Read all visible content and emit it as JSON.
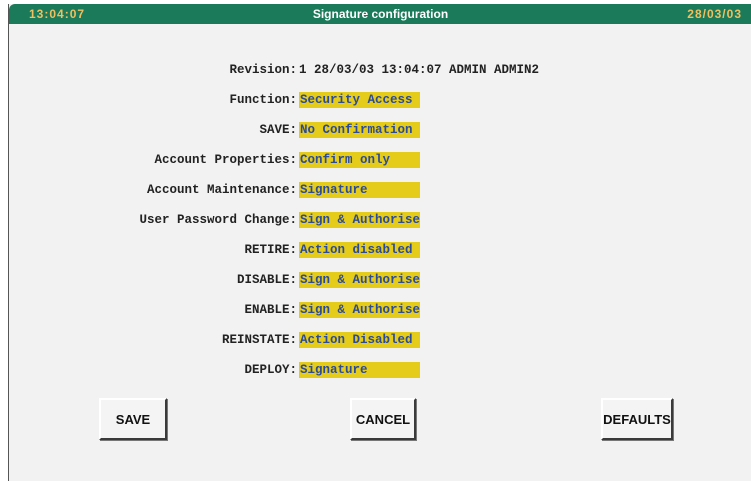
{
  "titlebar": {
    "time": "13:04:07",
    "title": "Signature configuration",
    "date": "28/03/03"
  },
  "revision": {
    "label": "Revision:",
    "value": "1 28/03/03 13:04:07 ADMIN ADMIN2"
  },
  "fields": [
    {
      "label": "Function:",
      "value": "Security Access"
    },
    {
      "label": "SAVE:",
      "value": "No Confirmation"
    },
    {
      "label": "Account Properties:",
      "value": "Confirm only"
    },
    {
      "label": "Account Maintenance:",
      "value": "Signature"
    },
    {
      "label": "User Password Change:",
      "value": "Sign & Authorise"
    },
    {
      "label": "RETIRE:",
      "value": "Action disabled"
    },
    {
      "label": "DISABLE:",
      "value": "Sign & Authorise"
    },
    {
      "label": "ENABLE:",
      "value": "Sign & Authorise"
    },
    {
      "label": "REINSTATE:",
      "value": "Action Disabled"
    },
    {
      "label": "DEPLOY:",
      "value": "Signature"
    }
  ],
  "buttons": {
    "save": "SAVE",
    "cancel": "CANCEL",
    "defaults": "DEFAULTS"
  },
  "colors": {
    "titlebar": "#1a7a5a",
    "field_background": "#e6cc1a",
    "field_text": "#2a4a9a"
  }
}
